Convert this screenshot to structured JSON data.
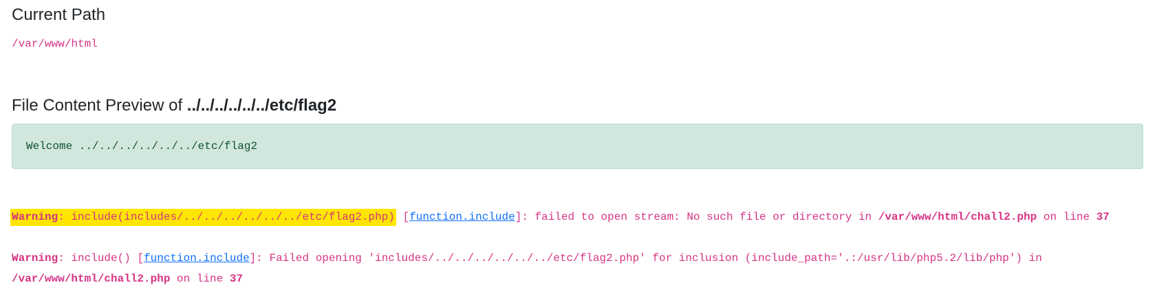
{
  "current_path": {
    "heading": "Current Path",
    "value": "/var/www/html"
  },
  "preview": {
    "heading_prefix": "File Content Preview of ",
    "heading_file": "../../../../../../etc/flag2",
    "content": "Welcome ../../../../../../etc/flag2"
  },
  "warnings": [
    {
      "label": "Warning",
      "message_start": ": include(includes/../../../../../../etc/flag2.php)",
      "link_text": "function.include",
      "message_end": "]: failed to open stream: No such file or directory in ",
      "file": "/var/www/html/chall2.php",
      "line_word": " on line ",
      "line_no": "37"
    },
    {
      "label": "Warning",
      "message_start": ": include()",
      "link_text": "function.include",
      "message_end": "]: Failed opening 'includes/../../../../../../etc/flag2.php' for inclusion (include_path='.:/usr/lib/php5.2/lib/php') in",
      "file": "/var/www/html/chall2.php",
      "line_word": " on line ",
      "line_no": "37"
    }
  ],
  "colors": {
    "code_pink": "#d63384",
    "alert_bg": "#d1e7dd",
    "alert_text": "#0f5132",
    "highlight": "#ffe600",
    "link_blue": "#0d6efd"
  }
}
